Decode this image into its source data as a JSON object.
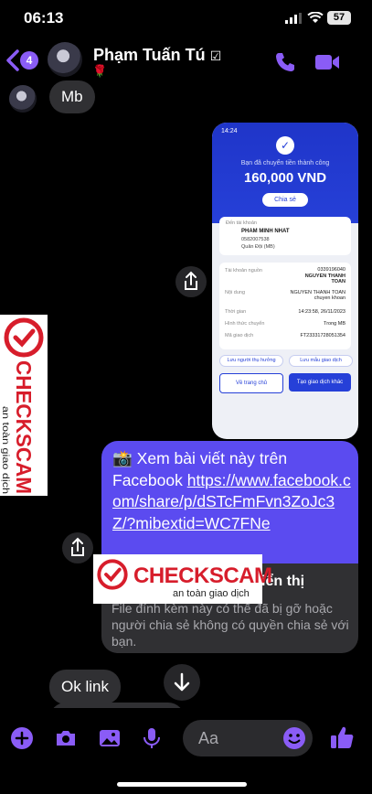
{
  "status_bar": {
    "time": "06:13",
    "battery": "57"
  },
  "header": {
    "back_count": "4",
    "contact_name": "Phạm Tuấn Tú",
    "verified_mark": "☑",
    "status_emoji": "🌹",
    "icons": [
      "back-chevron-icon",
      "phone-icon",
      "video-camera-icon"
    ],
    "accent_color": "#8a5cf6"
  },
  "messages": {
    "first_text": "Mb",
    "receipt": {
      "time": "14:24",
      "success_text": "Bạn đã chuyển tiền thành công",
      "amount": "160,000 VND",
      "share_label": "Chia sẻ",
      "to_account_label": "Đến tài khoản",
      "recipient_name": "PHAM MINH NHAT",
      "recipient_account": "0582007538",
      "recipient_bank": "Quân Đội (MB)",
      "source_label": "Tài khoản nguồn",
      "source_value": "0339196040",
      "source_name": "NGUYEN THANH TOAN",
      "content_label": "Nội dung",
      "content_value": "NGUYEN THANH TOAN chuyen khoan",
      "time_label": "Thời gian",
      "time_value": "14:23:58, 26/11/2023",
      "method_label": "Hình thức chuyển",
      "method_value": "Trong MB",
      "txn_label": "Mã giao dịch",
      "txn_value": "FT23331728051354",
      "save_recipient": "Lưu người thụ hưởng",
      "save_template": "Lưu mẫu giao dịch",
      "home_button": "Về trang chủ",
      "new_txn_button": "Tạo giao dịch khác",
      "brand_color": "#2640d8"
    },
    "facebook_share": {
      "emoji": "📸",
      "lead": "Xem bài viết này trên Facebook ",
      "link": "https://www.facebook.com/share/p/dSTcFmFvn3ZoJc3Z/?mibextid=WC7FNe",
      "card_title_visible": "iển thị",
      "card_text": "File đính kèm này có thể đã bị gỡ hoặc người chia sẻ không có quyền chia sẻ với bạn.",
      "bubble_color": "#5b4bf0"
    },
    "last_text": "Ok link"
  },
  "watermark": {
    "title": "CHECKSCAM",
    "subtitle": "an toàn giao dịch",
    "color": "#d71d2b"
  },
  "composer": {
    "placeholder": "Aa",
    "icons": [
      "plus-icon",
      "camera-icon",
      "image-icon",
      "microphone-icon",
      "emoji-icon",
      "thumbs-up-icon"
    ]
  }
}
